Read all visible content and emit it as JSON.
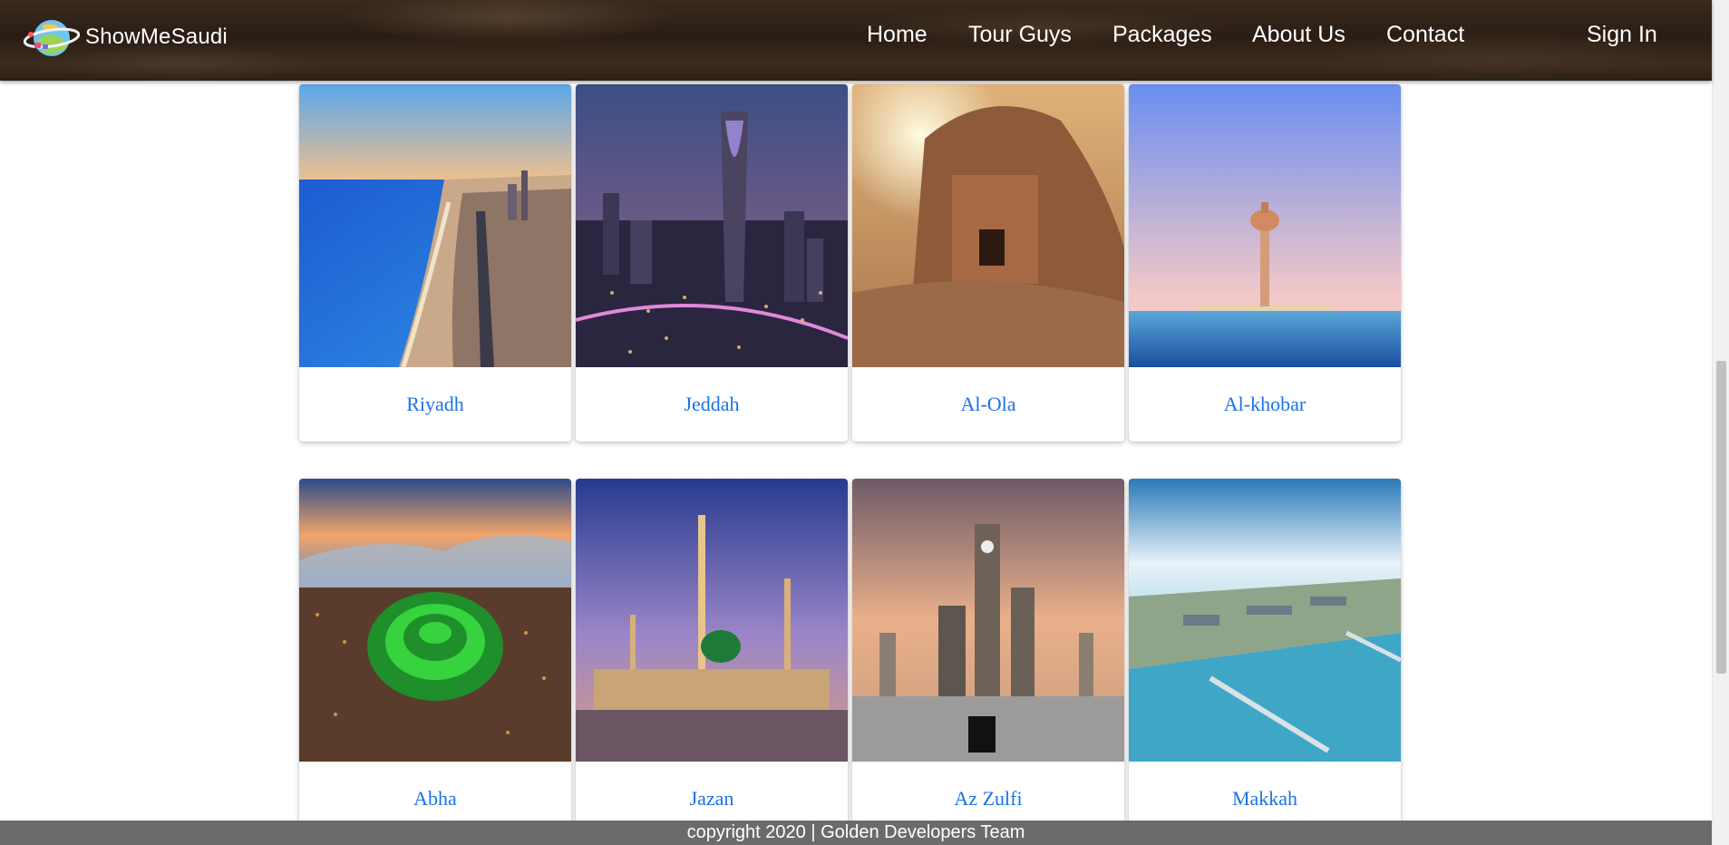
{
  "brand": {
    "name": "ShowMeSaudi",
    "logo_icon": "globe-logo-icon"
  },
  "nav": {
    "items": [
      {
        "label": "Home"
      },
      {
        "label": "Tour Guys"
      },
      {
        "label": "Packages"
      },
      {
        "label": "About Us"
      },
      {
        "label": "Contact"
      }
    ],
    "sign_in": "Sign In"
  },
  "cities": {
    "row1": [
      {
        "label": "Riyadh",
        "image": "coastal-city-aerial"
      },
      {
        "label": "Jeddah",
        "image": "skyline-tower-night"
      },
      {
        "label": "Al-Ola",
        "image": "rock-tomb-sunset"
      },
      {
        "label": "Al-khobar",
        "image": "water-tower-sea"
      }
    ],
    "row2": [
      {
        "label": "Abha",
        "image": "green-lit-hill-city"
      },
      {
        "label": "Jazan",
        "image": "mosque-dusk"
      },
      {
        "label": "Az Zulfi",
        "image": "clock-tower-kaaba"
      },
      {
        "label": "Makkah",
        "image": "port-aerial"
      }
    ]
  },
  "footer": {
    "text": "copyright 2020 | Golden Developers Team"
  },
  "colors": {
    "accent_link": "#1a73e8",
    "header_bg": "#2e2016",
    "footer_bg": "#6b6b6b"
  }
}
